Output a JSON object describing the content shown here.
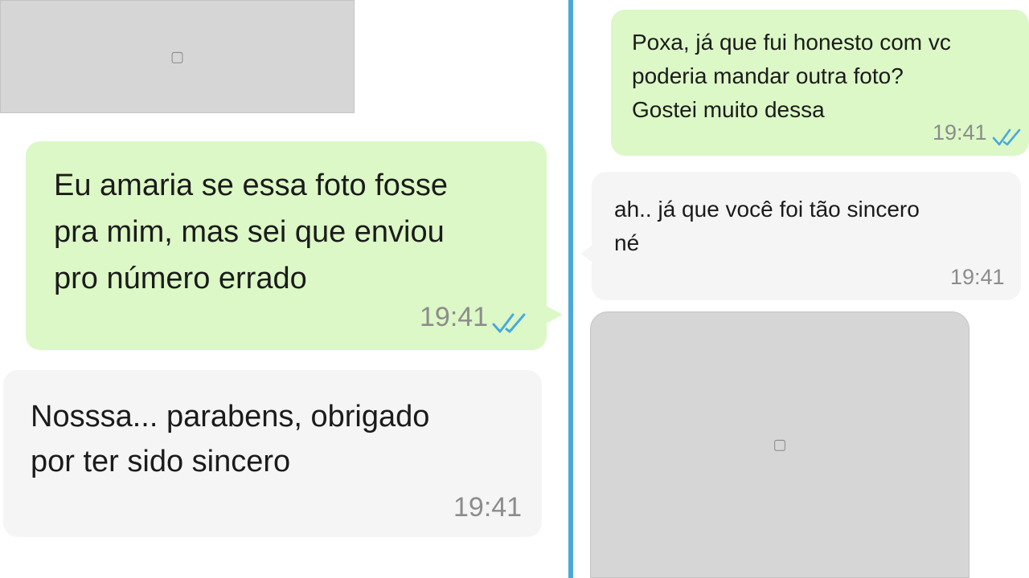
{
  "conversation": {
    "messages": [
      {
        "text": "Eu amaria se essa foto fosse\npra mim, mas sei que enviou\npro número errado",
        "time": "19:41"
      },
      {
        "text": "Nosssa... parabens, obrigado\npor ter sido sincero",
        "time": "19:41"
      },
      {
        "text": "Poxa, já que fui honesto com vc\npoderia mandar outra foto?\nGostei muito dessa",
        "time": "19:41"
      },
      {
        "text": "ah.. já que você foi tão sincero\nné",
        "time": "19:41"
      }
    ],
    "read_icon": "double-check-icon"
  },
  "colors": {
    "outgoing_bubble": "#dcf8c6",
    "incoming_bubble": "#f5f5f5",
    "divider": "#4aa9dc",
    "read_ticks": "#4aa9dc",
    "timestamp": "#8c8c8c"
  }
}
